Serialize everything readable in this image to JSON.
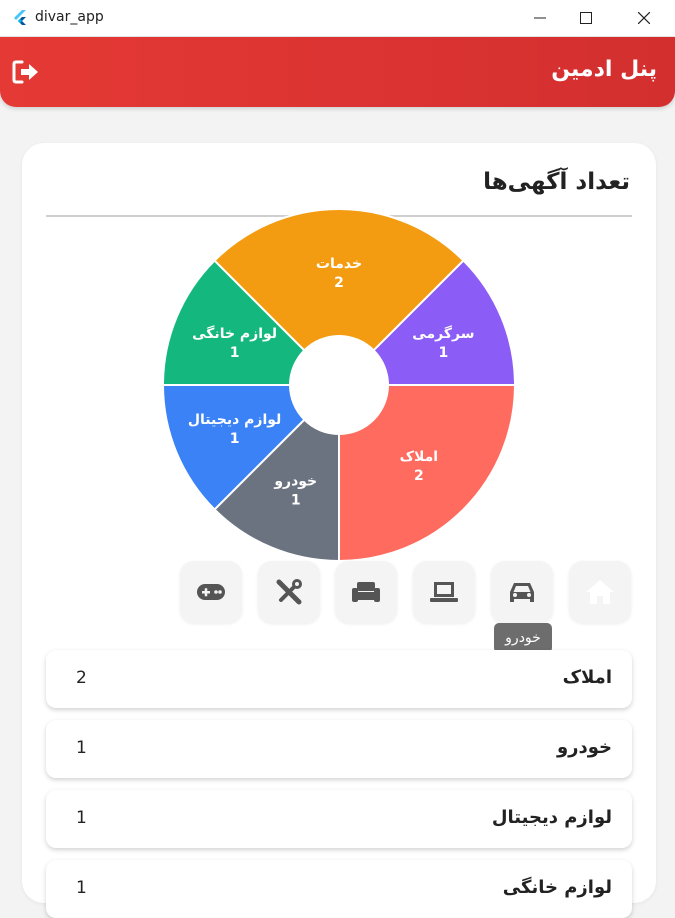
{
  "window": {
    "title": "divar_app"
  },
  "appbar": {
    "title": "پنل ادمین",
    "logout_icon": "logout-icon"
  },
  "card": {
    "title": "تعداد آگهی‌ها"
  },
  "chart_data": {
    "type": "pie",
    "donut": true,
    "slices": [
      {
        "label": "املاک",
        "value": 2,
        "color": "#ff6b5e"
      },
      {
        "label": "خودرو",
        "value": 1,
        "color": "#6b7280"
      },
      {
        "label": "لوازم دیجیتال",
        "value": 1,
        "color": "#3b82f6"
      },
      {
        "label": "لوازم خانگی",
        "value": 1,
        "color": "#14b87e"
      },
      {
        "label": "خدمات",
        "value": 2,
        "color": "#f39c12"
      },
      {
        "label": "سرگرمی",
        "value": 1,
        "color": "#8b5cf6"
      }
    ],
    "start": "right (3 o'clock)",
    "direction": "clockwise"
  },
  "categories": [
    {
      "name": "home",
      "icon": "home-icon",
      "active": true
    },
    {
      "name": "car",
      "icon": "car-icon",
      "active": false
    },
    {
      "name": "laptop",
      "icon": "laptop-icon",
      "active": false
    },
    {
      "name": "sofa",
      "icon": "sofa-icon",
      "active": false
    },
    {
      "name": "tools",
      "icon": "tools-icon",
      "active": false
    },
    {
      "name": "gamepad",
      "icon": "gamepad-icon",
      "active": false
    }
  ],
  "tooltip": {
    "text": "خودرو"
  },
  "rows": [
    {
      "label": "املاک",
      "count": "2"
    },
    {
      "label": "خودرو",
      "count": "1"
    },
    {
      "label": "لوازم دیجیتال",
      "count": "1"
    },
    {
      "label": "لوازم خانگی",
      "count": "1"
    }
  ],
  "colors": {
    "primary": "#e53935",
    "active_icon": "#ffffff",
    "inactive_icon": "#555555"
  }
}
